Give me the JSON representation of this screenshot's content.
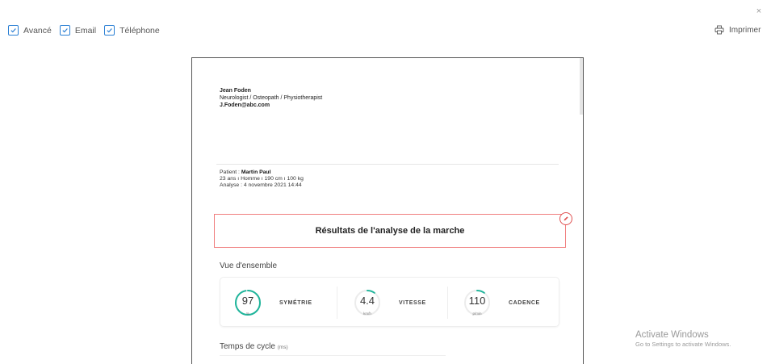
{
  "toolbar": {
    "close_symbol": "×",
    "options": [
      {
        "label": "Avancé",
        "checked": true
      },
      {
        "label": "Email",
        "checked": true
      },
      {
        "label": "Téléphone",
        "checked": true
      }
    ],
    "print_label": "Imprimer"
  },
  "doctor": {
    "name": "Jean Foden",
    "title": "Neurologist / Osteopath / Physiotherapist",
    "email": "J.Foden@abc.com"
  },
  "patient": {
    "label": "Patient : ",
    "name": "Martin Paul",
    "details": "23 ans  ı  Homme  ı  190 cm  ı  100 kg",
    "analysis": "Analyse : 4 novembre 2021 14:44"
  },
  "report": {
    "title": "Résultats de l'analyse de la marche",
    "overview_title": "Vue d'ensemble",
    "metrics": [
      {
        "value": "97",
        "unit": "%",
        "label": "SYMÉTRIE",
        "fill": 0.97
      },
      {
        "value": "4.4",
        "unit": "km/h",
        "label": "VITESSE",
        "fill": 0.2
      },
      {
        "value": "110",
        "unit": "p/min",
        "label": "CADENCE",
        "fill": 0.2
      }
    ],
    "cycle_title": "Temps de cycle",
    "cycle_unit": "(ms)"
  },
  "watermark": {
    "line1": "Activate Windows",
    "line2": "Go to Settings to activate Windows."
  },
  "colors": {
    "accent": "#2a7fd4",
    "gauge": "#1fb59b",
    "title_border": "#f07e7e"
  }
}
